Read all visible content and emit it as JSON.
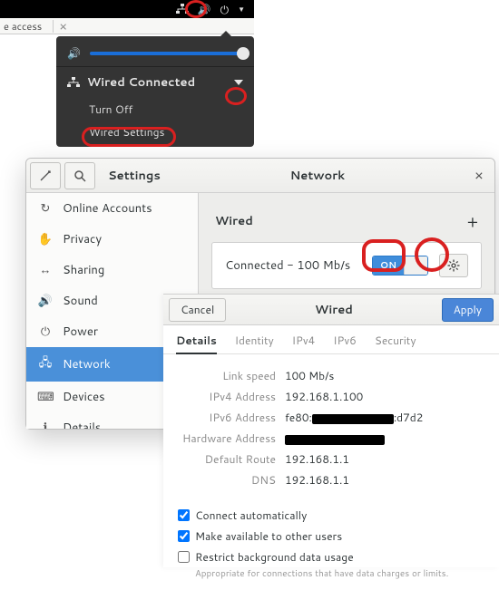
{
  "topbar": {
    "icons": [
      "network-icon",
      "volume-icon",
      "power-icon",
      "chevron-down-icon"
    ]
  },
  "browser_strip": {
    "text": "e access",
    "x_label": "×"
  },
  "sys_menu": {
    "wired_label": "Wired Connected",
    "turn_off_label": "Turn Off",
    "wired_settings_label": "Wired Settings"
  },
  "settings": {
    "title": "Settings",
    "panel_title": "Network",
    "close_glyph": "×",
    "sidebar": {
      "items": [
        {
          "label": "Online Accounts",
          "icon": "↻"
        },
        {
          "label": "Privacy",
          "icon": "✋"
        },
        {
          "label": "Sharing",
          "icon": "↔"
        },
        {
          "label": "Sound",
          "icon": "🔊"
        },
        {
          "label": "Power",
          "icon": "⏻"
        },
        {
          "label": "Network",
          "icon": "🖧"
        },
        {
          "label": "Devices",
          "icon": "⌨"
        },
        {
          "label": "Details",
          "icon": "ℹ"
        }
      ],
      "active_index": 5
    },
    "wired_section": {
      "heading": "Wired",
      "status": "Connected - 100 Mb/s",
      "switch_on": "ON",
      "plus": "+"
    }
  },
  "details_dialog": {
    "cancel_label": "Cancel",
    "apply_label": "Apply",
    "title": "Wired",
    "tabs": [
      "Details",
      "Identity",
      "IPv4",
      "IPv6",
      "Security"
    ],
    "active_tab": 0,
    "rows": {
      "link_speed_label": "Link speed",
      "link_speed": "100 Mb/s",
      "ipv4_label": "IPv4 Address",
      "ipv4": "192.168.1.100",
      "ipv6_label": "IPv6 Address",
      "ipv6_pre": "fe80:",
      "ipv6_suf": ":d7d2",
      "hw_label": "Hardware Address",
      "default_route_label": "Default Route",
      "default_route": "192.168.1.1",
      "dns_label": "DNS",
      "dns": "192.168.1.1"
    },
    "opts": {
      "connect_auto": "Connect automatically",
      "all_users": "Make available to other users",
      "restrict_label": "Restrict background data usage",
      "restrict_sub": "Appropriate for connections that have data charges or limits."
    }
  }
}
